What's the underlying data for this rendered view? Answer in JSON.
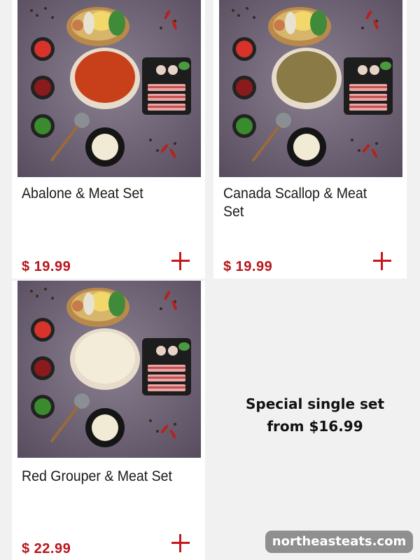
{
  "menu": {
    "items": [
      {
        "name": "Abalone & Meat Set",
        "price": "$ 19.99",
        "soup_color": "#c8401a",
        "meat": "pork-belly-and-abalone"
      },
      {
        "name": "Canada Scallop & Meat Set",
        "price": "$ 19.99",
        "soup_color": "#8a7a45",
        "meat": "beef-and-meatballs"
      },
      {
        "name": "Red Grouper & Meat Set",
        "price": "$ 22.99",
        "soup_color": "#f3ecd8",
        "meat": "pork-belly"
      }
    ]
  },
  "promo": {
    "line1": "Special single set",
    "line2": "from $16.99"
  },
  "watermark": {
    "text": "northeasteats.com"
  },
  "colors": {
    "price": "#b8151b",
    "plus": "#c8161d",
    "backdrop": "#6c6272"
  }
}
